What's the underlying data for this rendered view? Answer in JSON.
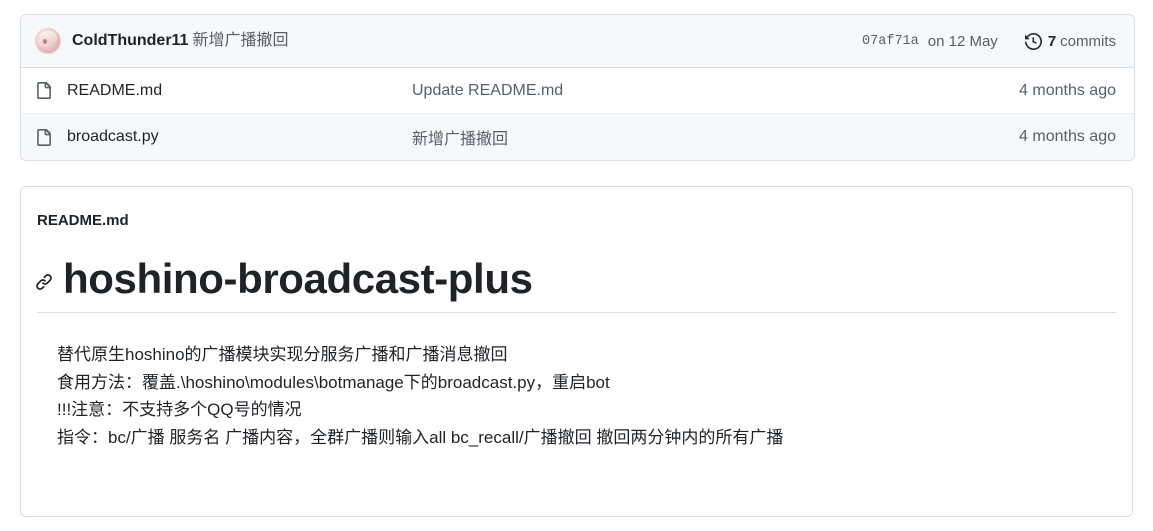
{
  "latest_commit": {
    "avatar_name": "user-avatar",
    "author": "ColdThunder11",
    "message": "新增广播撤回",
    "sha": "07af71a",
    "date": "on 12 May",
    "history_icon": "history-icon",
    "commits_count": "7",
    "commits_label": "commits"
  },
  "file_table": {
    "columns": [
      "name",
      "commit_message",
      "time"
    ],
    "rows": [
      {
        "icon": "file-icon",
        "name": "README.md",
        "commit_message": "Update README.md",
        "time": "4 months ago"
      },
      {
        "icon": "file-icon",
        "name": "broadcast.py",
        "commit_message": "新增广播撤回",
        "time": "4 months ago"
      }
    ]
  },
  "readme": {
    "label": "README.md",
    "anchor_icon": "link-icon",
    "heading": "hoshino-broadcast-plus",
    "paragraph_lines": [
      "替代原生hoshino的广播模块实现分服务广播和广播消息撤回",
      "食用方法：覆盖.\\hoshino\\modules\\botmanage下的broadcast.py，重启bot",
      "!!!注意：不支持多个QQ号的情况",
      "指令：bc/广播 服务名 广播内容，全群广播则输入all bc_recall/广播撤回 撤回两分钟内的所有广播"
    ]
  },
  "colors": {
    "border": "#d8dee4",
    "header_bg": "#f6f8fa",
    "row_alt_bg": "#f6f8fa",
    "text_primary": "#1f2328",
    "text_muted": "#57606a",
    "page_bg": "#ffffff"
  }
}
